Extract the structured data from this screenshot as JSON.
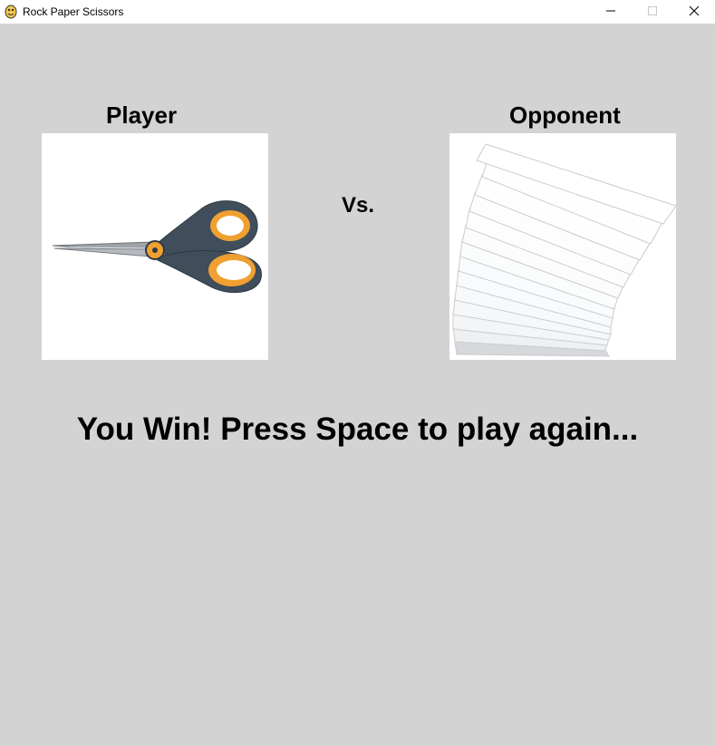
{
  "window": {
    "title": "Rock Paper Scissors",
    "app_icon": "pygame-snake-icon",
    "controls": [
      "minimize-icon",
      "maximize-icon",
      "close-icon"
    ]
  },
  "game": {
    "player_label": "Player",
    "opponent_label": "Opponent",
    "vs_label": "Vs.",
    "player_choice": "scissors",
    "opponent_choice": "paper",
    "result_message": "You Win! Press Space to play again...",
    "background_color": "#d3d3d3"
  }
}
